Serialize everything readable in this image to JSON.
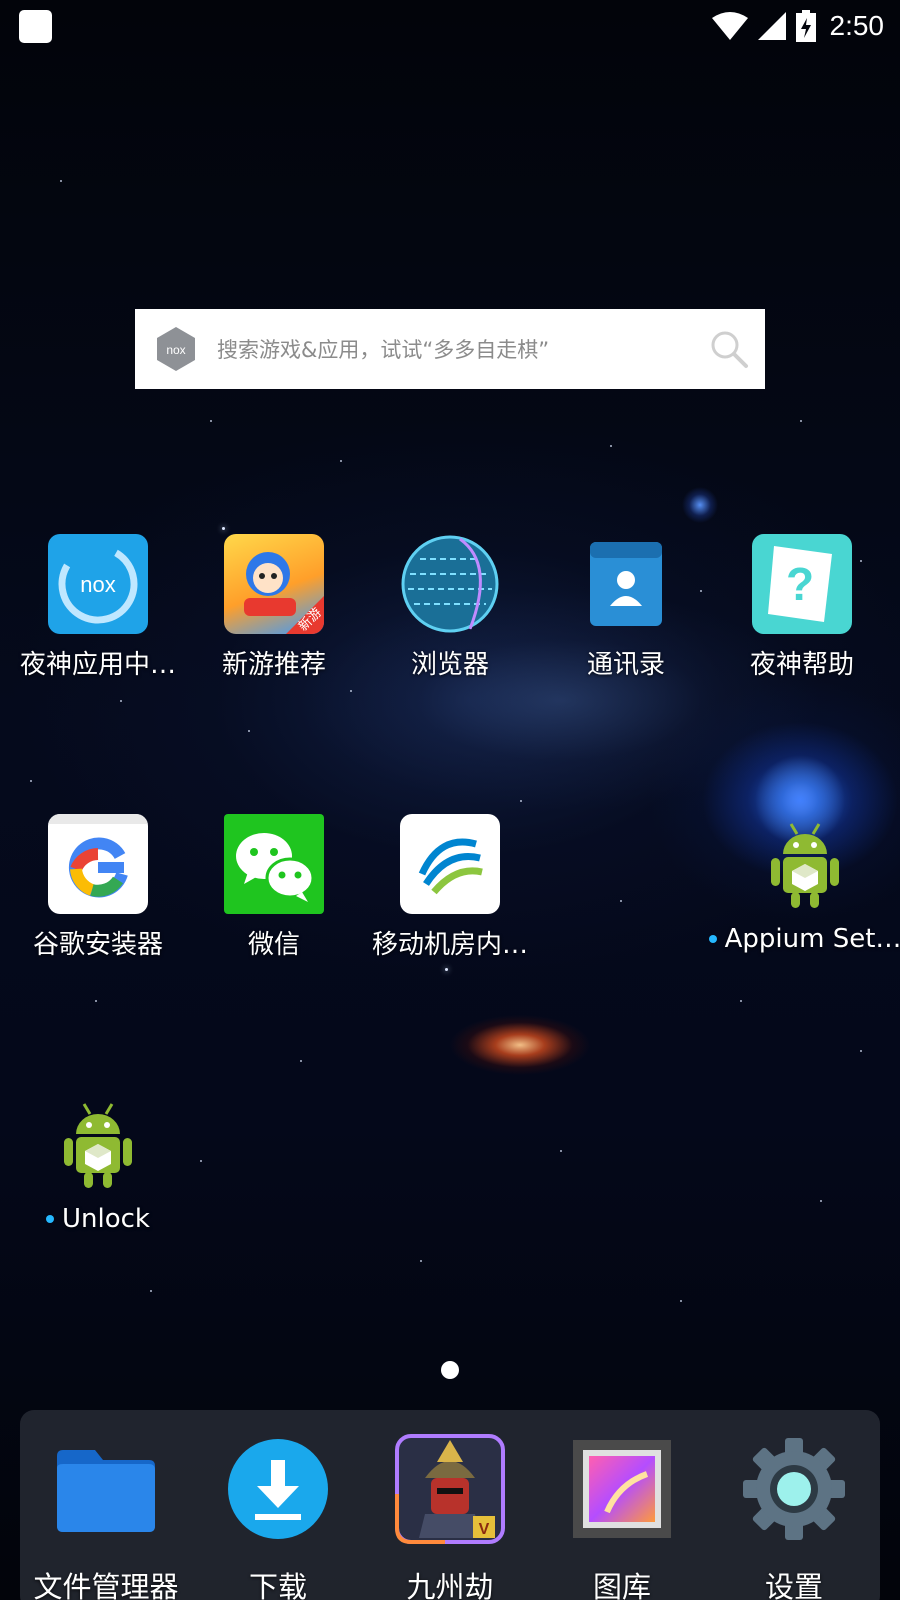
{
  "status_bar": {
    "time": "2:50",
    "icons": [
      "notification-square-icon",
      "wifi-icon",
      "cell-signal-icon",
      "battery-charging-icon"
    ]
  },
  "search": {
    "placeholder": "搜索游戏&应用，试试“多多自走棋”",
    "logo": "nox-logo-icon",
    "icon": "search-icon"
  },
  "home_apps": [
    {
      "label": "夜神应用中…",
      "icon": "nox-app-center-icon"
    },
    {
      "label": "新游推荐",
      "icon": "new-games-icon",
      "badge": "新游"
    },
    {
      "label": "浏览器",
      "icon": "browser-globe-icon"
    },
    {
      "label": "通讯录",
      "icon": "contacts-icon"
    },
    {
      "label": "夜神帮助",
      "icon": "nox-help-icon"
    },
    {
      "label": "谷歌安装器",
      "icon": "google-installer-icon"
    },
    {
      "label": "微信",
      "icon": "wechat-icon"
    },
    {
      "label": "移动机房内…",
      "icon": "china-mobile-icon"
    },
    {
      "label": "Appium Set…",
      "icon": "android-robot-icon",
      "new_dot": true
    },
    {
      "label": "Unlock",
      "icon": "android-robot-icon",
      "new_dot": true
    }
  ],
  "dock": [
    {
      "label": "文件管理器",
      "icon": "folder-icon"
    },
    {
      "label": "下载",
      "icon": "download-icon"
    },
    {
      "label": "九州劫",
      "icon": "samurai-game-icon"
    },
    {
      "label": "图库",
      "icon": "gallery-icon"
    },
    {
      "label": "设置",
      "icon": "settings-gear-icon"
    }
  ],
  "colors": {
    "wallpaper": "#03050d",
    "accent_dot": "#25b8ff",
    "dock_bg": "#2d303a",
    "wechat_green": "#1fc51f",
    "nox_blue": "#1fa3e8"
  },
  "page_indicator": {
    "current": 1,
    "total": 1
  }
}
